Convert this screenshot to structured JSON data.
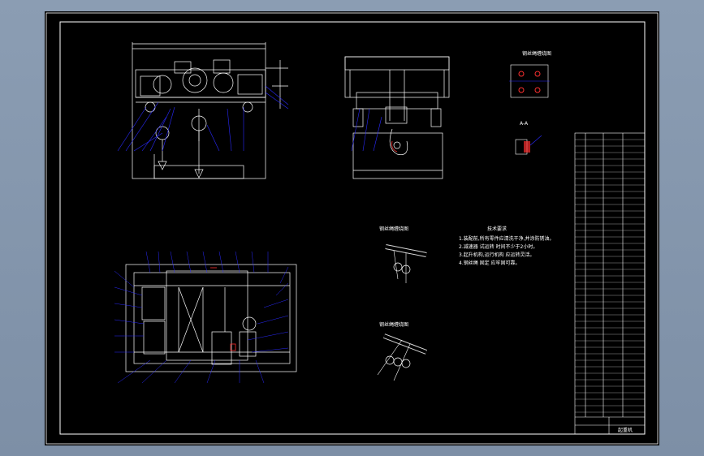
{
  "title_block": {
    "text": "起重机"
  },
  "notes": {
    "heading": "技术要求",
    "lines": [
      "1.装配前,所有零件应清洗干净,并涂防锈油。",
      "2.减速器 试运转 时间不少于2小时。",
      "3.起升机构,运行机构 应运转灵活。",
      "4.钢丝绳 固定 应牢固可靠。"
    ]
  },
  "detail_labels": {
    "top_right": "钢丝绳缠绕图",
    "hook": "A-A",
    "rope1": "钢丝绳缠绕图",
    "rope2": "钢丝绳缠绕图"
  },
  "colors": {
    "line": "#ffffff",
    "leader": "#2a2aff",
    "accent": "#ff3030",
    "background": "#000000"
  }
}
